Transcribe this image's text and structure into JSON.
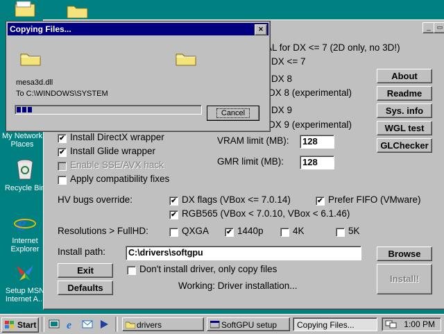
{
  "desktop": {
    "icons": [
      {
        "label": "My Network Places",
        "line1": "My Network",
        "line2": "Places",
        "icon": "network-places-icon"
      },
      {
        "label": "Recycle Bin",
        "line1": "Recycle Bin",
        "icon": "recycle-bin-icon"
      },
      {
        "label": "Internet Explorer",
        "line1": "Internet",
        "line2": "Explorer",
        "icon": "internet-explorer-icon"
      },
      {
        "label": "Setup MSN Internet A...",
        "line1": "Setup MSN",
        "line2": "Internet A...",
        "icon": "msn-setup-icon"
      }
    ]
  },
  "main": {
    "dx_options": {
      "wrapper_only": "AL for DX <= 7 (2D only, no 3D!)",
      "dx7": "DX <= 7",
      "dx8": "DX 8",
      "dx8_exp": "DX 8 (experimental)",
      "dx9": "DX 9",
      "dx9_exp": "DX 9 (experimental)"
    },
    "options": {
      "install_directx": "Install DirectX wrapper",
      "install_glide": "Install Glide wrapper",
      "enable_sse": "Enable SSE/AVX hack",
      "compat_fixes": "Apply compatibility fixes"
    },
    "vram_label": "VRAM limit (MB):",
    "vram_value": "128",
    "gmr_label": "GMR limit (MB):",
    "gmr_value": "128",
    "buttons": {
      "about": "About",
      "readme": "Readme",
      "sysinfo": "Sys. info",
      "wgltest": "WGL test",
      "glchecker": "GLChecker",
      "browse": "Browse",
      "install": "Install!",
      "exit": "Exit",
      "defaults": "Defaults"
    },
    "hv": {
      "label": "HV bugs override:",
      "dx_flags": "DX flags (VBox <= 7.0.14)",
      "prefer_fifo": "Prefer FIFO (VMware)",
      "rgb565": "RGB565 (VBox < 7.0.10, VBox < 6.1.46)"
    },
    "res": {
      "label": "Resolutions > FullHD:",
      "qxga": "QXGA",
      "p1440": "1440p",
      "k4": "4K",
      "k5": "5K"
    },
    "install_path_label": "Install path:",
    "install_path_value": "C:\\drivers\\softgpu",
    "copy_only": "Don't install driver, only copy files",
    "status": "Working: Driver installation..."
  },
  "copy_dialog": {
    "title": "Copying Files...",
    "file": "mesa3d.dll",
    "dest": "To C:\\WINDOWS\\SYSTEM",
    "progress": 0.09,
    "cancel": "Cancel"
  },
  "taskbar": {
    "start": "Start",
    "tasks": [
      "drivers",
      "SoftGPU setup",
      "Copying Files..."
    ],
    "time": "1:00 PM"
  }
}
